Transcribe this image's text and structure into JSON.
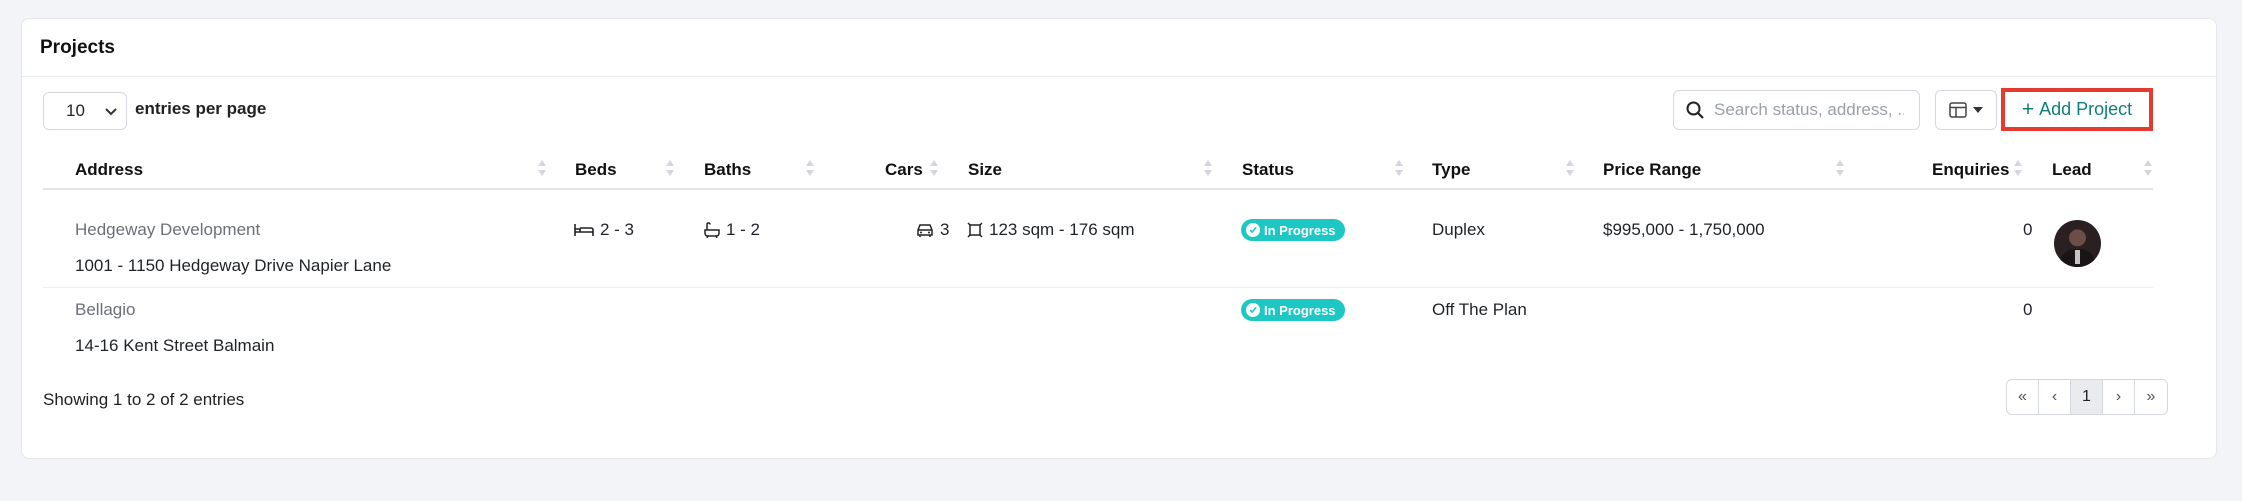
{
  "card": {
    "title": "Projects"
  },
  "controls": {
    "entries_value": "10",
    "entries_label": "entries per page",
    "search_placeholder": "Search status, address, ...",
    "add_button_label": "Add Project"
  },
  "table": {
    "headers": {
      "address": "Address",
      "beds": "Beds",
      "baths": "Baths",
      "cars": "Cars",
      "size": "Size",
      "status": "Status",
      "type": "Type",
      "price": "Price Range",
      "enquiries": "Enquiries",
      "lead": "Lead"
    },
    "rows": [
      {
        "name": "Hedgeway Development",
        "address": "1001 - 1150 Hedgeway Drive Napier Lane",
        "beds": "2 - 3",
        "baths": "1 - 2",
        "cars": "3",
        "size": "123 sqm - 176 sqm",
        "status": "In Progress",
        "type": "Duplex",
        "price": "$995,000 - 1,750,000",
        "enquiries": "0"
      },
      {
        "name": "Bellagio",
        "address": "14-16 Kent Street Balmain",
        "status": "In Progress",
        "type": "Off The Plan",
        "enquiries": "0"
      }
    ]
  },
  "footer": {
    "info": "Showing 1 to 2 of 2 entries",
    "pager": {
      "first": "«",
      "prev": "‹",
      "current": "1",
      "next": "›",
      "last": "»"
    }
  },
  "colors": {
    "accent": "#0f7f79",
    "status_badge": "#1dc8c4",
    "highlight": "#e53a2f"
  }
}
